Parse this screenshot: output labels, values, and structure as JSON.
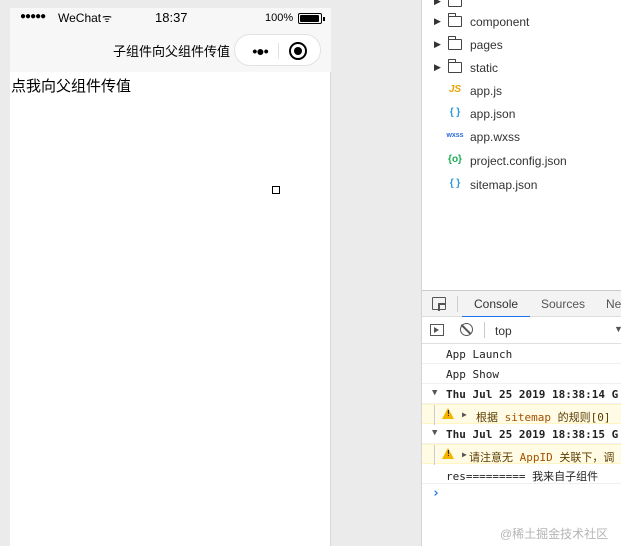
{
  "simulator": {
    "status": {
      "signal": "●●●●●",
      "carrier": "WeChat",
      "wifi": "ᯤ",
      "time": "18:37",
      "battery": "100%"
    },
    "navbar": {
      "title": "子组件向父组件传值",
      "more_glyph": "•●•"
    },
    "page": {
      "button_text": "点我向父组件传值"
    }
  },
  "filetree": {
    "items": [
      {
        "type": "folder",
        "name": "component"
      },
      {
        "type": "folder",
        "name": "pages"
      },
      {
        "type": "folder",
        "name": "static"
      },
      {
        "type": "file",
        "name": "app.js",
        "icon": "JS",
        "icon_color": "#e8a400"
      },
      {
        "type": "file",
        "name": "app.json",
        "icon": "{ }",
        "icon_color": "#2d9bd6"
      },
      {
        "type": "file",
        "name": "app.wxss",
        "icon": "wxss",
        "icon_color": "#2d6bd6"
      },
      {
        "type": "file",
        "name": "project.config.json",
        "icon": "{o}",
        "icon_color": "#1aad52"
      },
      {
        "type": "file",
        "name": "sitemap.json",
        "icon": "{ }",
        "icon_color": "#2d9bd6"
      }
    ]
  },
  "devtools": {
    "tabs": [
      "Console",
      "Sources",
      "Ne"
    ],
    "active_tab": "Console",
    "context": "top",
    "logs": [
      {
        "kind": "plain",
        "text": "App Launch"
      },
      {
        "kind": "plain",
        "text": "App Show"
      },
      {
        "kind": "group",
        "text": "Thu Jul 25 2019 18:38:14 G"
      },
      {
        "kind": "warn",
        "pre": "根据 ",
        "hl": "sitemap",
        "post": " 的规则[0]"
      },
      {
        "kind": "group",
        "text": "Thu Jul 25 2019 18:38:15 G"
      },
      {
        "kind": "warn",
        "pre": "请注意无 ",
        "hl": "AppID",
        "post": " 关联下，调"
      },
      {
        "kind": "plain",
        "text": "res========= 我来自子组件"
      }
    ],
    "prompt": "›",
    "watermark": "@稀土掘金技术社区"
  },
  "colors": {
    "accent": "#1a73e8",
    "warn_bg": "#fffbe5",
    "warn_icon": "#f5b400"
  }
}
